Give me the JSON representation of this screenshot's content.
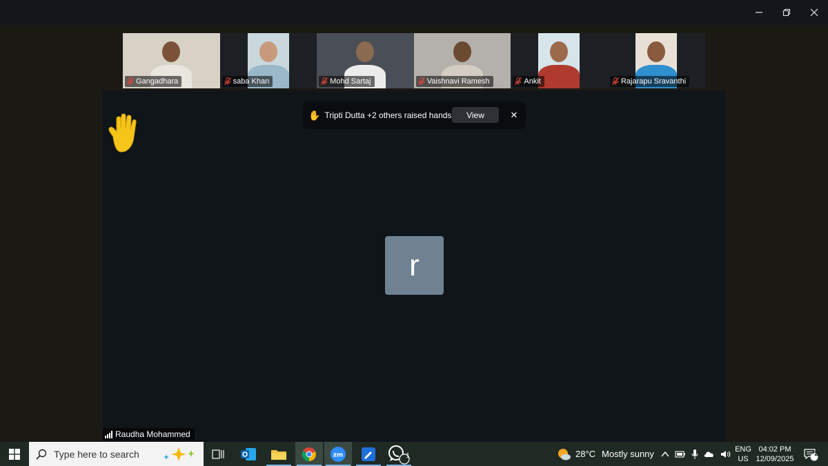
{
  "participants": [
    {
      "name": "Gangadhara",
      "bg": "#d8d2c6",
      "skin": "#7a5238",
      "shirt": "#e9e6df"
    },
    {
      "name": "saba Khan",
      "bg": "#c9d8dc",
      "skin": "#c79a7c",
      "shirt": "#9ab8c8"
    },
    {
      "name": "Mohd Sartaj",
      "bg": "#4a4e56",
      "skin": "#8a6a50",
      "shirt": "#ececec"
    },
    {
      "name": "Vaishnavi Ramesh",
      "bg": "#b4b0ac",
      "skin": "#6b4a32",
      "shirt": "#d4cdc4"
    },
    {
      "name": "Ankit",
      "bg": "#d7e4ea",
      "skin": "#9a6a4a",
      "shirt": "#b03a2e"
    },
    {
      "name": "Rajarapu Sravanthi",
      "bg": "#e8e0d6",
      "skin": "#8a5a3e",
      "shirt": "#2f8fcf"
    }
  ],
  "notification": {
    "text": "Tripti Dutta +2 others raised hands",
    "view_label": "View",
    "close_label": "✕"
  },
  "stage": {
    "avatar_letter": "r",
    "speaker_name": "Raudha Mohammed"
  },
  "taskbar": {
    "search_placeholder": "Type here to search",
    "weather_temp": "28°C",
    "weather_desc": "Mostly sunny",
    "lang_top": "ENG",
    "lang_bottom": "US",
    "time": "04:02 PM",
    "date": "12/09/2025",
    "whatsapp_badge": "1",
    "notif_badge": "2"
  },
  "colors": {
    "stage_bg": "#10151a",
    "avatar_bg": "#6f8291",
    "taskbar_bg": "#1f2a24",
    "mute_red": "#e0453a"
  }
}
